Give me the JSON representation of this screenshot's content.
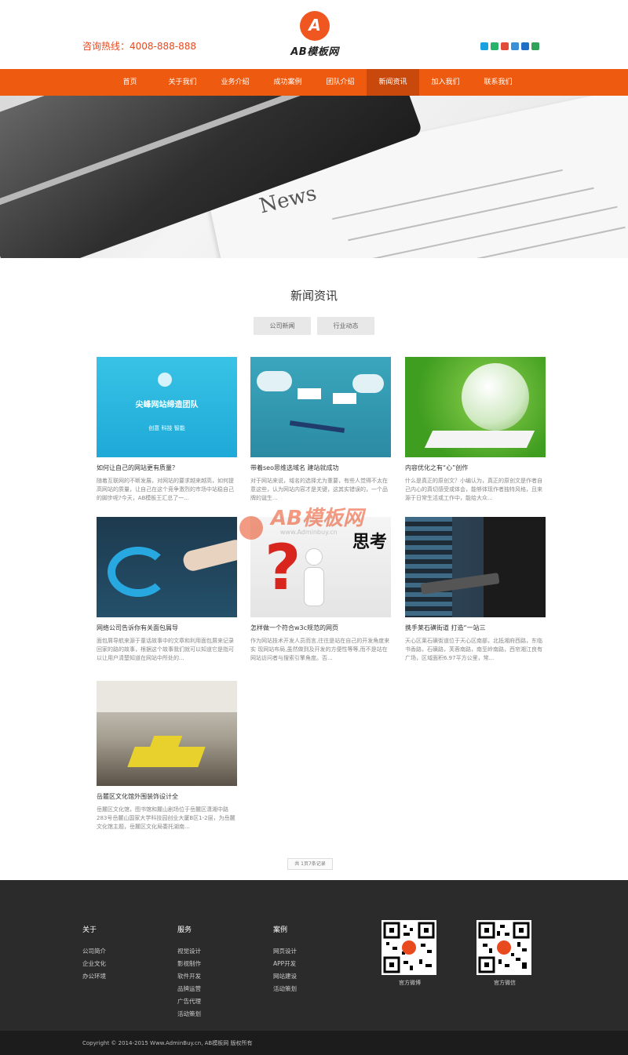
{
  "header": {
    "hotline": "咨询热线：4008-888-888",
    "logo_mark": "A",
    "logo_text": "AB模板网",
    "social_colors": [
      "#1aa1e0",
      "#29b36a",
      "#e24a3a",
      "#3a8fd6",
      "#1e6fc5",
      "#31a25a"
    ]
  },
  "nav": {
    "items": [
      "首页",
      "关于我们",
      "业务介绍",
      "成功案例",
      "团队介绍",
      "新闻资讯",
      "加入我们",
      "联系我们"
    ],
    "active_index": 5,
    "color": "#ee5a10"
  },
  "banner": {
    "word": "News"
  },
  "section": {
    "title": "新闻资讯",
    "tabs": [
      "公司新闻",
      "行业动态"
    ]
  },
  "cards": [
    {
      "title": "如何让自己的网站更有质量？",
      "excerpt": "随着互联网的不断发展，对网站的要求越来越高，如何提高网站的质量，让自己在这个竞争激烈的市场中站稳自己的脚步呢?今天，AB模板王汇总了一...",
      "thumb_text": "尖峰网站缔造团队",
      "thumb_sub": "创意 科技 智能"
    },
    {
      "title": "带着seo思维选域名 建站就成功",
      "excerpt": "对于网站来说，域名的选择尤为重要，有些人觉得不太在意这些，认为网站内容才是关键，这其实错误的，一个品牌的诞生...",
      "thumb_text": "",
      "thumb_sub": ""
    },
    {
      "title": "内容优化之有“心”创作",
      "excerpt": "什么是真正的原创文？小编认为，真正的原创文是作者自己内心的真切感受或体会，能够体现作者独特风格，且来源于日常生活或工作中，能给大众...",
      "thumb_text": "",
      "thumb_sub": ""
    },
    {
      "title": "网络公司告诉你有关面包屑导",
      "excerpt": "面包屑导航来源于童话故事中的文章和利用面包屑来记录回家的路的故事，根据这个故事我们就可以知道它是指可以让用户清楚知道在网站中所处的...",
      "thumb_text": "",
      "thumb_sub": ""
    },
    {
      "title": "怎样做一个符合w3c规范的网页",
      "excerpt": "作为网站技术开发人员而言,往往是站在自己的开发角度来实 现网站布局,虽然做到及开发的方便性等等,而不是站在网站访问者与搜索引擎角度。否...",
      "thumb_text": "思考",
      "thumb_sub": ""
    },
    {
      "title": "携手莱石磺街道 打造“一站三",
      "excerpt": "天心区莱石磺街道位于天心区南部，北抵湘府西路，东临书香路，石磺路，芙蓉南路，南至岭南路，西帘湘江良有广场，区域面积6.97平方公里，常...",
      "thumb_text": "",
      "thumb_sub": ""
    },
    {
      "title": "岳麓区文化馆外围装饰设计全",
      "excerpt": "岳麓区文化馆，图书馆和麓山剧场位于岳麓区潇湘中路283号岳麓山国家大学科技园创业大厦B区1-2层，为岳麓文化馆主题，岳麓区文化局委托湖南...",
      "thumb_text": "",
      "thumb_sub": ""
    }
  ],
  "pager": "共 1页7条记录",
  "watermark": {
    "text": "AB模板网",
    "url": "www.Adminbuy.cn"
  },
  "footer": {
    "columns": [
      {
        "heading": "关于",
        "items": [
          "公司简介",
          "企业文化",
          "办公环境"
        ]
      },
      {
        "heading": "服务",
        "items": [
          "视觉设计",
          "影视制作",
          "软件开发",
          "品牌运营",
          "广告代理",
          "活动策划"
        ]
      },
      {
        "heading": "案例",
        "items": [
          "网页设计",
          "APP开发",
          "网站建设",
          "活动策划"
        ]
      }
    ],
    "qr": [
      {
        "caption": "官方微博"
      },
      {
        "caption": "官方微信"
      }
    ],
    "copyright": "Copyright © 2014-2015 Www.AdminBuy.cn, AB模板网 版权所有"
  }
}
